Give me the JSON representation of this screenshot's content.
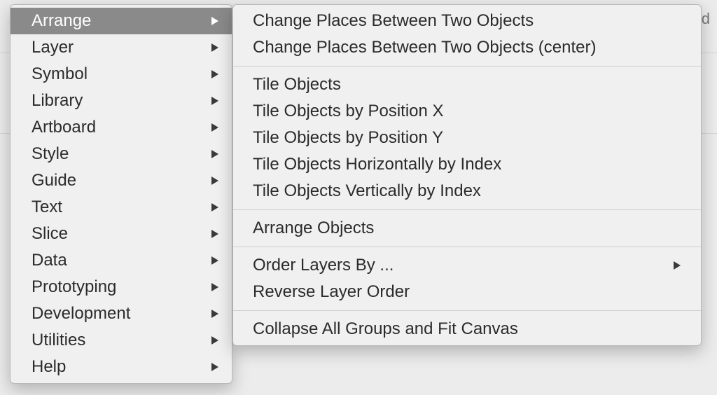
{
  "left_menu": {
    "items": [
      {
        "label": "Arrange",
        "submenu": true,
        "highlight": true
      },
      {
        "label": "Layer",
        "submenu": true,
        "highlight": false
      },
      {
        "label": "Symbol",
        "submenu": true,
        "highlight": false
      },
      {
        "label": "Library",
        "submenu": true,
        "highlight": false
      },
      {
        "label": "Artboard",
        "submenu": true,
        "highlight": false
      },
      {
        "label": "Style",
        "submenu": true,
        "highlight": false
      },
      {
        "label": "Guide",
        "submenu": true,
        "highlight": false
      },
      {
        "label": "Text",
        "submenu": true,
        "highlight": false
      },
      {
        "label": "Slice",
        "submenu": true,
        "highlight": false
      },
      {
        "label": "Data",
        "submenu": true,
        "highlight": false
      },
      {
        "label": "Prototyping",
        "submenu": true,
        "highlight": false
      },
      {
        "label": "Development",
        "submenu": true,
        "highlight": false
      },
      {
        "label": "Utilities",
        "submenu": true,
        "highlight": false
      },
      {
        "label": "Help",
        "submenu": true,
        "highlight": false
      }
    ]
  },
  "right_menu": {
    "groups": [
      [
        {
          "label": "Change Places Between Two Objects",
          "submenu": false
        },
        {
          "label": "Change Places Between Two Objects (center)",
          "submenu": false
        }
      ],
      [
        {
          "label": "Tile Objects",
          "submenu": false
        },
        {
          "label": "Tile Objects by Position X",
          "submenu": false
        },
        {
          "label": "Tile Objects by Position Y",
          "submenu": false
        },
        {
          "label": "Tile Objects Horizontally by Index",
          "submenu": false
        },
        {
          "label": "Tile Objects Vertically by Index",
          "submenu": false
        }
      ],
      [
        {
          "label": "Arrange Objects",
          "submenu": false
        }
      ],
      [
        {
          "label": "Order Layers By ...",
          "submenu": true
        },
        {
          "label": "Reverse Layer Order",
          "submenu": false
        }
      ],
      [
        {
          "label": "Collapse All Groups and Fit Canvas",
          "submenu": false
        }
      ]
    ]
  },
  "bg_partial": "d"
}
